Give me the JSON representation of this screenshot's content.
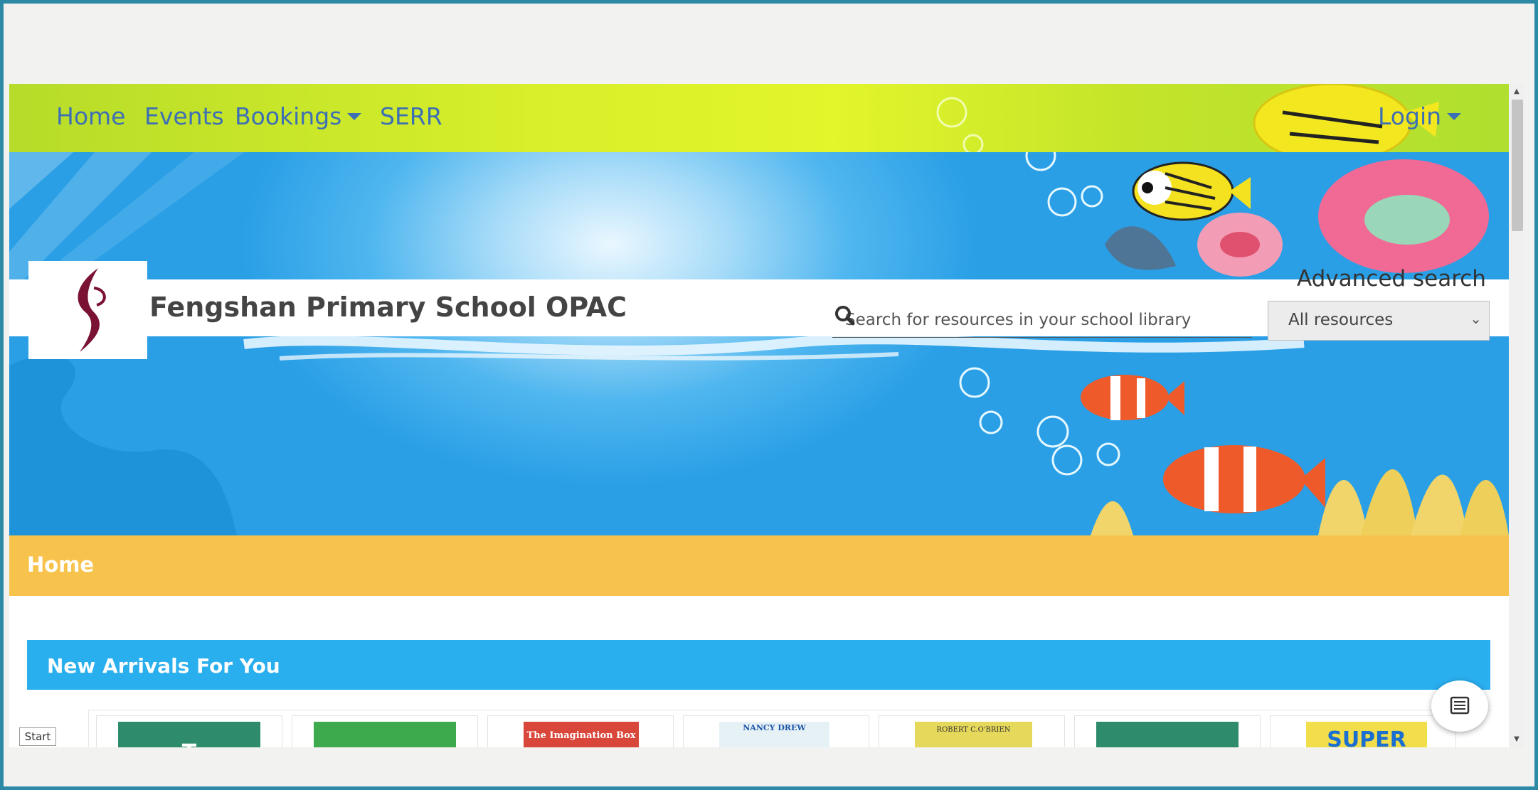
{
  "nav": {
    "home": "Home",
    "events": "Events",
    "bookings": "Bookings",
    "serr": "SERR",
    "login": "Login"
  },
  "header": {
    "site_title": "Fengshan Primary School OPAC",
    "advanced_search": "Advanced search"
  },
  "search": {
    "placeholder": "Search for resources in your school library",
    "scope_selected": "All resources"
  },
  "page": {
    "title": "Home"
  },
  "new_arrivals": {
    "title": "New Arrivals For You",
    "books": [
      {
        "cover_color": "#2e8b6b",
        "cover_text": "T"
      },
      {
        "cover_color": "#3daa4e",
        "cover_text": ""
      },
      {
        "cover_color": "#d9463a",
        "cover_text": "The Imagination Box"
      },
      {
        "cover_color": "#e6f1f6",
        "cover_text": "NANCY DREW"
      },
      {
        "cover_color": "#e6d85a",
        "cover_text": "ROBERT C.O'BRIEN"
      },
      {
        "cover_color": "#2e8b6b",
        "cover_text": ""
      },
      {
        "cover_color": "#f2de4a",
        "cover_text": "SUPER"
      }
    ]
  },
  "start_label": "Start",
  "colors": {
    "nav_link": "#3d6fb5",
    "nav_bar": "#d8ef2a",
    "home_bar": "#f8c34c",
    "section_bar": "#29aeee",
    "frame": "#2d8aa6"
  },
  "icons": [
    "search-icon",
    "list-icon",
    "caret-down-icon",
    "chevron-down-icon",
    "school-logo"
  ]
}
